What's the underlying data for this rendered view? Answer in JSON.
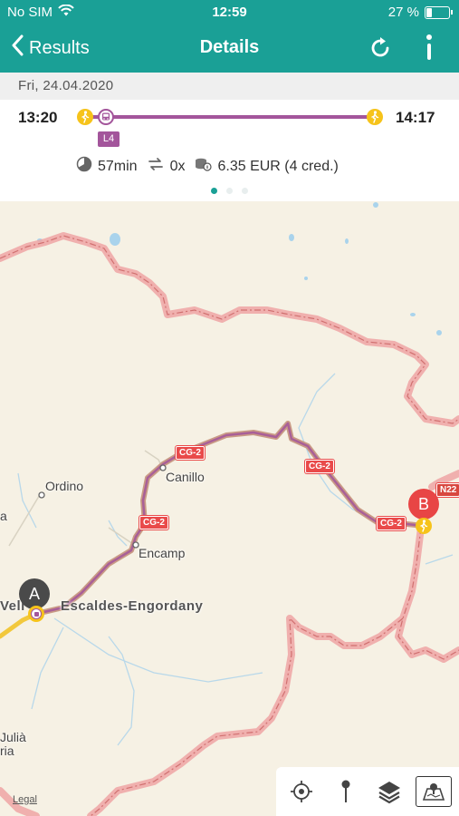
{
  "status": {
    "carrier": "No SIM",
    "time": "12:59",
    "battery": "27 %",
    "battery_level": 0.27
  },
  "nav": {
    "back_label": "Results",
    "title": "Details"
  },
  "trip": {
    "date": "Fri, 24.04.2020",
    "departure": "13:20",
    "arrival": "14:17",
    "line": "L4",
    "duration": "57min",
    "transfers": "0x",
    "price": "6.35 EUR (4 cred.)",
    "page_count": 3,
    "active_page": 1
  },
  "map": {
    "places": {
      "ordino": "Ordino",
      "canillo": "Canillo",
      "encamp": "Encamp",
      "escaldes": "Escaldes-Engordany",
      "vella_partial": "Vell",
      "julia_partial": "Julià",
      "ria_partial": "ria",
      "a_partial": "a"
    },
    "roads": {
      "cg2": "CG-2",
      "n22": "N22"
    },
    "pins": {
      "start": "A",
      "end": "B"
    },
    "legal": "Legal",
    "route_color": "#a3559b",
    "border_color": "#f0a0a0"
  },
  "colors": {
    "primary": "#1aa096",
    "bus_line": "#a3559b",
    "walk": "#f6c31a"
  }
}
